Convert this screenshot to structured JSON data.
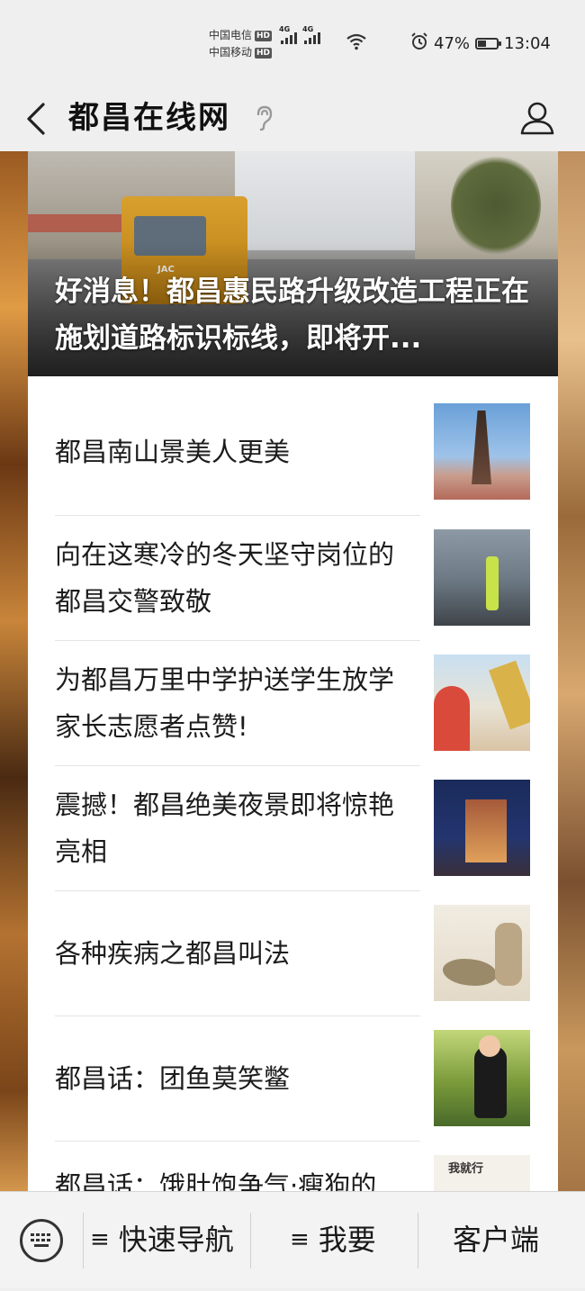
{
  "status_bar": {
    "carrier1": "中国电信",
    "carrier2": "中国移动",
    "hd": "HD",
    "net1": "4G",
    "net2": "4G",
    "battery": "47%",
    "battery_level": 0.47,
    "time": "13:04"
  },
  "header": {
    "title": "都昌在线网"
  },
  "hero": {
    "title": "好消息！都昌惠民路升级改造工程正在施划道路标识标线，即将开..."
  },
  "articles": [
    {
      "title": "都昌南山景美人更美"
    },
    {
      "title": "向在这寒冷的冬天坚守岗位的都昌交警致敬"
    },
    {
      "title": "为都昌万里中学护送学生放学家长志愿者点赞!"
    },
    {
      "title": "震撼！都昌绝美夜景即将惊艳亮相"
    },
    {
      "title": "各种疾病之都昌叫法"
    },
    {
      "title": "都昌话：团鱼莫笑鳖"
    },
    {
      "title": "都昌话：饿肚饱争气·瘦狗的"
    }
  ],
  "bottom_bar": {
    "nav_label": "快速导航",
    "want_label": "我要",
    "client_label": "客户端",
    "menu_glyph": "≡"
  },
  "icons": {
    "back": "back-chevron-icon",
    "ear": "ear-icon",
    "profile": "person-icon",
    "keyboard": "keyboard-icon"
  },
  "colors": {
    "accent_bg": "#efefef",
    "text": "#1c1c1c"
  }
}
